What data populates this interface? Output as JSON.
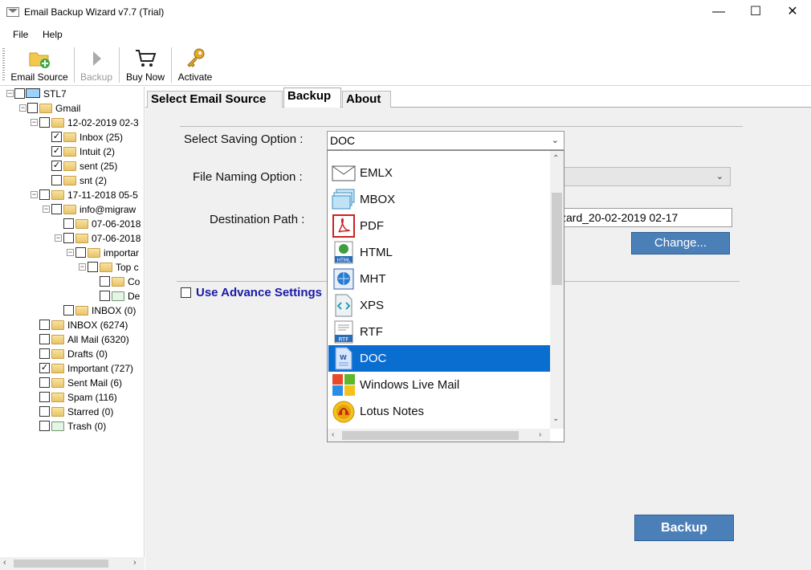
{
  "window": {
    "title": "Email Backup Wizard v7.7 (Trial)",
    "minimize": "—",
    "maximize": "☐",
    "close": "✕"
  },
  "menu": [
    "File",
    "Help"
  ],
  "toolbar": {
    "email_source": "Email Source",
    "backup": "Backup",
    "buy_now": "Buy Now",
    "activate": "Activate"
  },
  "tree": {
    "root": "STL7",
    "gmail": "Gmail",
    "folder_a": "12-02-2019 02-3",
    "inbox": "Inbox (25)",
    "intuit": "Intuit (2)",
    "sent": "sent (25)",
    "snt": "snt (2)",
    "folder_b": "17-11-2018 05-5",
    "info": "info@migraw",
    "d1": "07-06-2018",
    "d2": "07-06-2018",
    "important_sub": "importar",
    "top": "Top c",
    "co": "Co",
    "de": "De",
    "inbox0": "INBOX (0)",
    "inbox6274": "INBOX (6274)",
    "allmail": "All Mail (6320)",
    "drafts": "Drafts (0)",
    "important": "Important (727)",
    "sentmail": "Sent Mail (6)",
    "spam": "Spam (116)",
    "starred": "Starred (0)",
    "trash": "Trash (0)"
  },
  "tabs": {
    "select_source": "Select Email Source",
    "backup": "Backup",
    "about": "About"
  },
  "form": {
    "saving_label": "Select Saving Option :",
    "saving_value": "DOC",
    "naming_label": "File Naming Option :",
    "dest_label": "Destination Path :",
    "dest_value": "zard_20-02-2019 02-17",
    "change_btn": "Change...",
    "advance": "Use Advance Settings",
    "backup_btn": "Backup"
  },
  "dropdown_options": [
    "EMLX",
    "MBOX",
    "PDF",
    "HTML",
    "MHT",
    "XPS",
    "RTF",
    "DOC",
    "Windows Live Mail",
    "Lotus Notes"
  ],
  "selected_option": "DOC",
  "colors": {
    "accent": "#0a6dd0",
    "button": "#4b7fb8",
    "advance_text": "#1a1aa6"
  }
}
